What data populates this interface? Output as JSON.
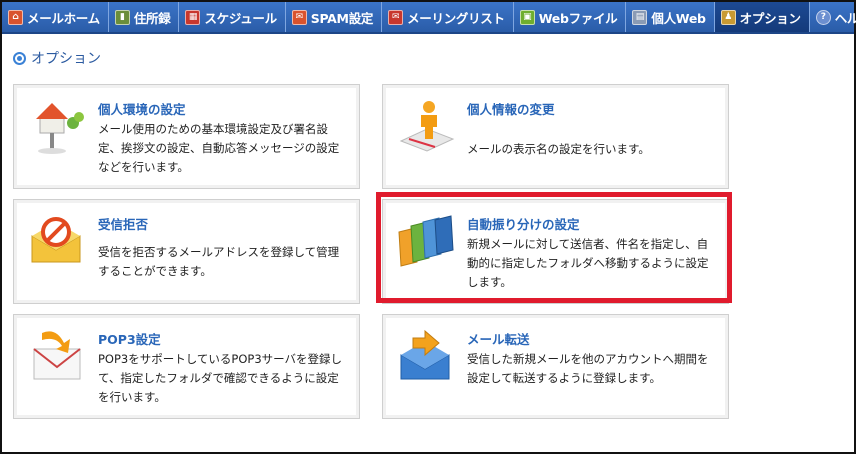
{
  "nav": {
    "items": [
      {
        "label": "メールホーム",
        "icon": "home-icon",
        "color": "#d9532e"
      },
      {
        "label": "住所録",
        "icon": "addressbook-icon",
        "color": "#6b8e3a"
      },
      {
        "label": "スケジュール",
        "icon": "calendar-icon",
        "color": "#c8372d"
      },
      {
        "label": "SPAM設定",
        "icon": "spam-icon",
        "color": "#d9532e"
      },
      {
        "label": "メーリングリスト",
        "icon": "mailinglist-icon",
        "color": "#c8372d"
      },
      {
        "label": "Webファイル",
        "icon": "webfile-icon",
        "color": "#6fae2e"
      },
      {
        "label": "個人Web",
        "icon": "personalweb-icon",
        "color": "#8a9bb5"
      },
      {
        "label": "オプション",
        "icon": "option-icon",
        "color": "#c99a33"
      },
      {
        "label": "ヘルプ",
        "icon": "help-icon",
        "color": "#6c8fd0"
      }
    ],
    "active_index": 7
  },
  "page": {
    "title": "オプション"
  },
  "cards": [
    {
      "title": "個人環境の設定",
      "desc": "メール使用のための基本環境設定及び署名設定、挨拶文の設定、自動応答メッセージの設定などを行います。",
      "icon": "house-settings-icon"
    },
    {
      "title": "個人情報の変更",
      "desc": "メールの表示名の設定を行います。",
      "icon": "person-info-icon"
    },
    {
      "title": "受信拒否",
      "desc": "受信を拒否するメールアドレスを登録して管理することができます。",
      "icon": "block-mail-icon"
    },
    {
      "title": "自動振り分けの設定",
      "desc": "新規メールに対して送信者、件名を指定し、自動的に指定したフォルダへ移動するように設定します。",
      "icon": "folders-sort-icon"
    },
    {
      "title": "POP3設定",
      "desc": "POP3をサポートしているPOP3サーバを登録して、指定したフォルダで確認できるように設定を行います。",
      "icon": "pop3-mail-icon"
    },
    {
      "title": "メール転送",
      "desc": "受信した新規メールを他のアカウントへ期間を設定して転送するように登録します。",
      "icon": "mail-forward-icon"
    }
  ],
  "colors": {
    "nav_bg": "#2a5ca8",
    "title_blue": "#2966b8",
    "highlight": "#e01b2d"
  }
}
